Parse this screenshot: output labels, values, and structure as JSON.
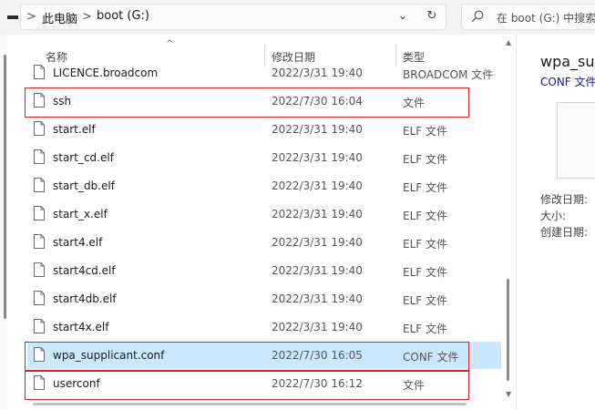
{
  "address_bar": {
    "crumbs": [
      "此电脑",
      "boot (G:)"
    ],
    "separator": ">",
    "dropdown_glyph": "⌄",
    "refresh_glyph": "↻"
  },
  "search": {
    "placeholder": "在 boot (G:) 中搜索"
  },
  "columns": {
    "name": "名称",
    "date": "修改日期",
    "type": "类型",
    "sort_glyph": "^"
  },
  "files": [
    {
      "name": "LICENCE.broadcom",
      "date": "2022/3/31 19:40",
      "type": "BROADCOM 文件",
      "selected": false,
      "highlighted": false
    },
    {
      "name": "ssh",
      "date": "2022/7/30 16:04",
      "type": "文件",
      "selected": false,
      "highlighted": true
    },
    {
      "name": "start.elf",
      "date": "2022/3/31 19:40",
      "type": "ELF 文件",
      "selected": false,
      "highlighted": false
    },
    {
      "name": "start_cd.elf",
      "date": "2022/3/31 19:40",
      "type": "ELF 文件",
      "selected": false,
      "highlighted": false
    },
    {
      "name": "start_db.elf",
      "date": "2022/3/31 19:40",
      "type": "ELF 文件",
      "selected": false,
      "highlighted": false
    },
    {
      "name": "start_x.elf",
      "date": "2022/3/31 19:40",
      "type": "ELF 文件",
      "selected": false,
      "highlighted": false
    },
    {
      "name": "start4.elf",
      "date": "2022/3/31 19:40",
      "type": "ELF 文件",
      "selected": false,
      "highlighted": false
    },
    {
      "name": "start4cd.elf",
      "date": "2022/3/31 19:40",
      "type": "ELF 文件",
      "selected": false,
      "highlighted": false
    },
    {
      "name": "start4db.elf",
      "date": "2022/3/31 19:40",
      "type": "ELF 文件",
      "selected": false,
      "highlighted": false
    },
    {
      "name": "start4x.elf",
      "date": "2022/3/31 19:40",
      "type": "ELF 文件",
      "selected": false,
      "highlighted": false
    },
    {
      "name": "wpa_supplicant.conf",
      "date": "2022/7/30 16:05",
      "type": "CONF 文件",
      "selected": true,
      "highlighted": true
    },
    {
      "name": "userconf",
      "date": "2022/7/30 16:12",
      "type": "文件",
      "selected": false,
      "highlighted": true
    }
  ],
  "details": {
    "title": "wpa_sup",
    "subtitle": "CONF 文件",
    "props": [
      "修改日期:",
      "大小:",
      "创建日期:"
    ]
  },
  "colors": {
    "selection": "#cce8ff",
    "highlight_box": "#d42020"
  },
  "icons": {
    "file": "file-icon",
    "search": "search-icon"
  }
}
